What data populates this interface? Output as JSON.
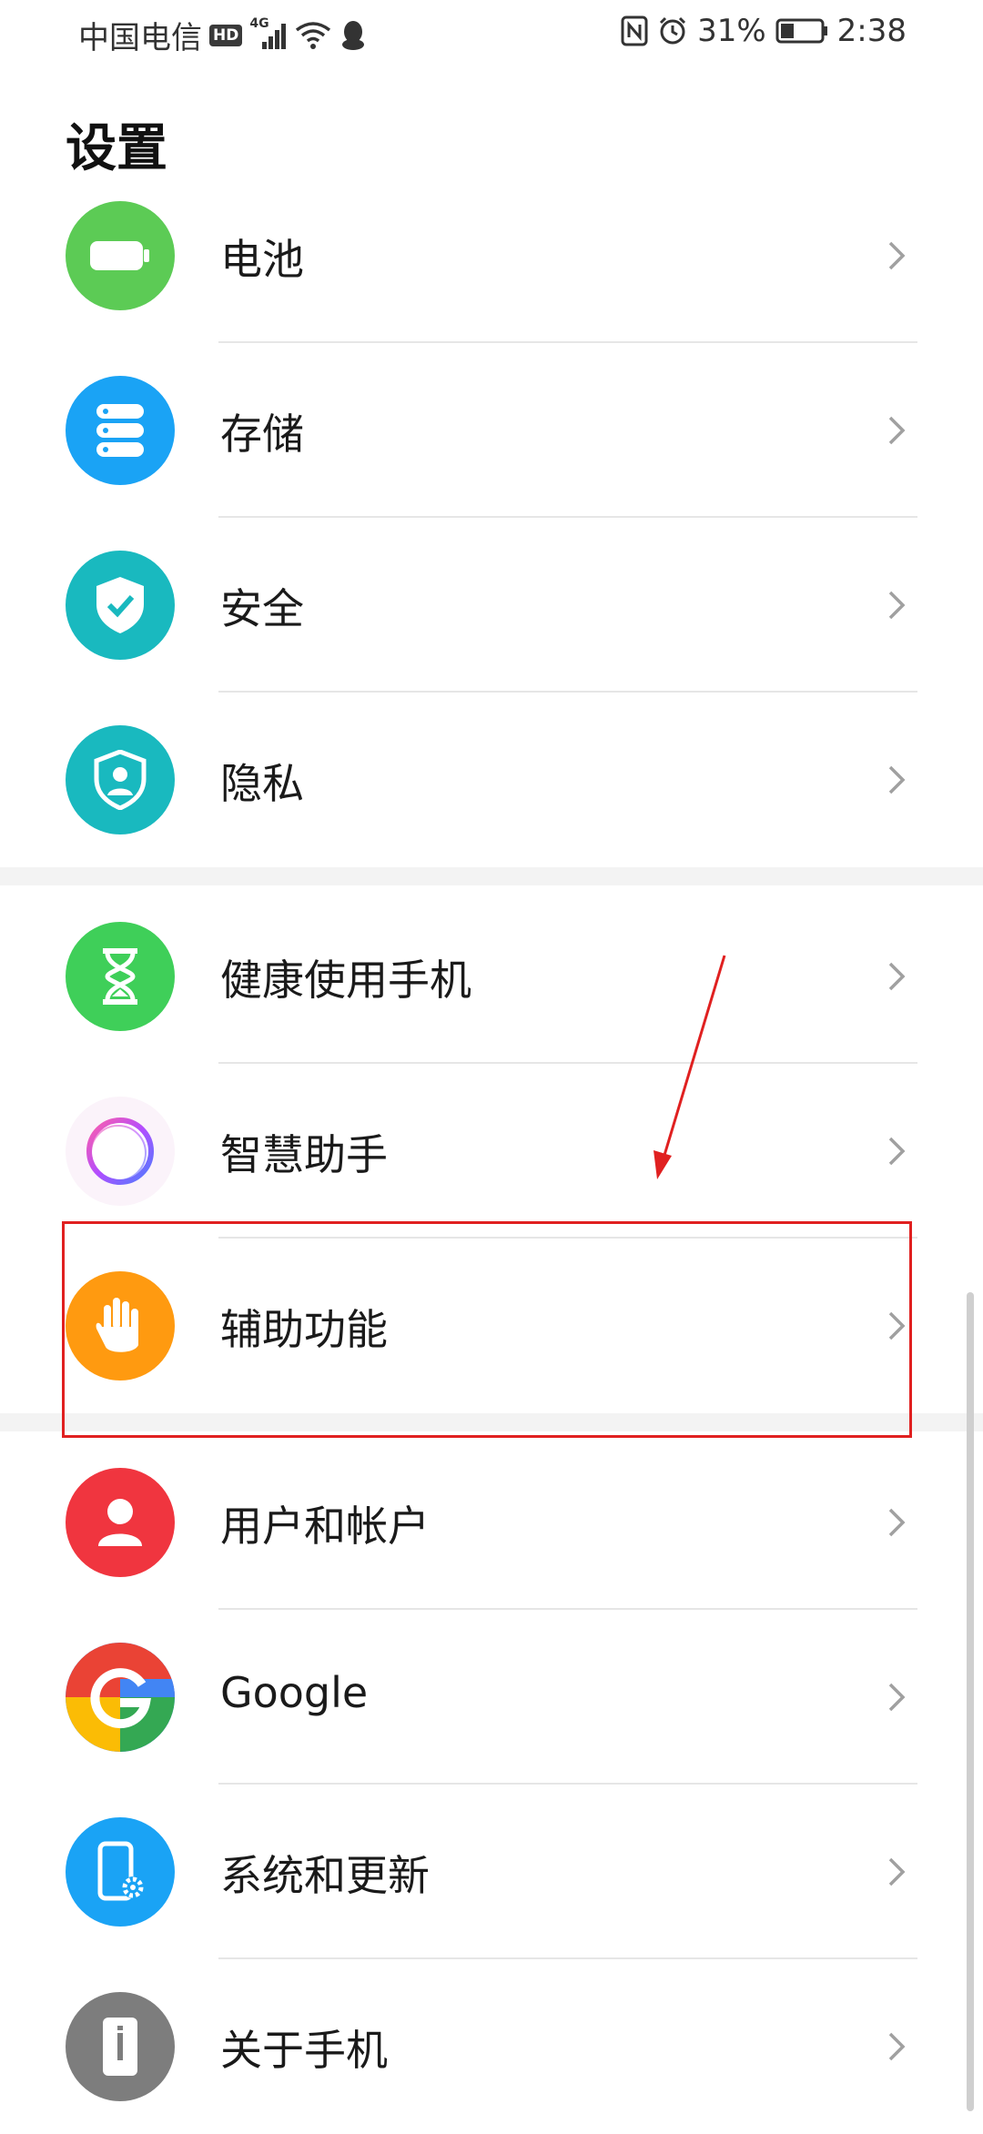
{
  "status_bar": {
    "carrier": "中国电信",
    "hd": "HD",
    "network": "4G",
    "battery_percent": "31%",
    "time": "2:38"
  },
  "page": {
    "title": "设置"
  },
  "items": [
    {
      "label": "电池",
      "icon": "battery-icon",
      "color": "#5ccb55"
    },
    {
      "label": "存储",
      "icon": "storage-icon",
      "color": "#1aa3f5"
    },
    {
      "label": "安全",
      "icon": "shield-check-icon",
      "color": "#19b9bf"
    },
    {
      "label": "隐私",
      "icon": "privacy-icon",
      "color": "#19b9bf"
    },
    {
      "label": "健康使用手机",
      "icon": "hourglass-icon",
      "color": "#3fcf59"
    },
    {
      "label": "智慧助手",
      "icon": "assistant-icon",
      "color": "#ffffff"
    },
    {
      "label": "辅助功能",
      "icon": "hand-icon",
      "color": "#ff9a10"
    },
    {
      "label": "用户和帐户",
      "icon": "user-icon",
      "color": "#f0353f"
    },
    {
      "label": "Google",
      "icon": "google-icon",
      "color": "#4285f4"
    },
    {
      "label": "系统和更新",
      "icon": "phone-gear-icon",
      "color": "#1aa3f5"
    },
    {
      "label": "关于手机",
      "icon": "phone-info-icon",
      "color": "#7d7d7d"
    }
  ]
}
